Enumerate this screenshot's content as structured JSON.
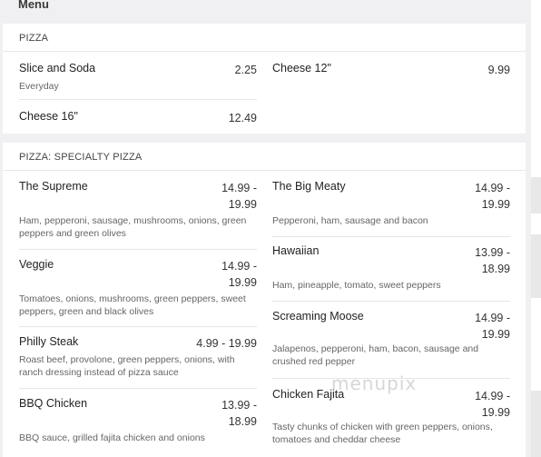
{
  "header": {
    "title": "Menu"
  },
  "sections": [
    {
      "title": "PIZZA",
      "items": [
        {
          "name": "Slice and Soda",
          "price": "2.25",
          "desc": "Everyday"
        },
        {
          "name": "Cheese 16\"",
          "price": "12.49",
          "desc": ""
        },
        {
          "name": "Cheese 12\"",
          "price": "9.99",
          "desc": ""
        }
      ]
    },
    {
      "title": "PIZZA: SPECIALTY PIZZA",
      "items": [
        {
          "name": "The Supreme",
          "price": "14.99 -\n19.99",
          "desc": "Ham, pepperoni, sausage, mushrooms, onions, green peppers and green olives"
        },
        {
          "name": "Veggie",
          "price": "14.99 -\n19.99",
          "desc": "Tomatoes, onions, mushrooms, green peppers, sweet peppers, green and black olives"
        },
        {
          "name": "Philly Steak",
          "price": "4.99 - 19.99",
          "desc": "Roast beef, provolone, green peppers, onions, with ranch dressing instead of pizza sauce"
        },
        {
          "name": "BBQ Chicken",
          "price": "13.99 -\n18.99",
          "desc": "BBQ sauce, grilled fajita chicken and onions"
        },
        {
          "name": "The Big Meaty",
          "price": "14.99 -\n19.99",
          "desc": "Pepperoni, ham, sausage and bacon"
        },
        {
          "name": "Hawaiian",
          "price": "13.99 -\n18.99",
          "desc": "Ham, pineapple, tomato, sweet peppers"
        },
        {
          "name": "Screaming Moose",
          "price": "14.99 -\n19.99",
          "desc": "Jalapenos, pepperoni, ham, bacon, sausage and crushed red pepper"
        },
        {
          "name": "Chicken Fajita",
          "price": "14.99 -\n19.99",
          "desc": "Tasty chunks of chicken with green peppers, onions, tomatoes and cheddar cheese"
        }
      ]
    }
  ],
  "watermark": "menupix"
}
